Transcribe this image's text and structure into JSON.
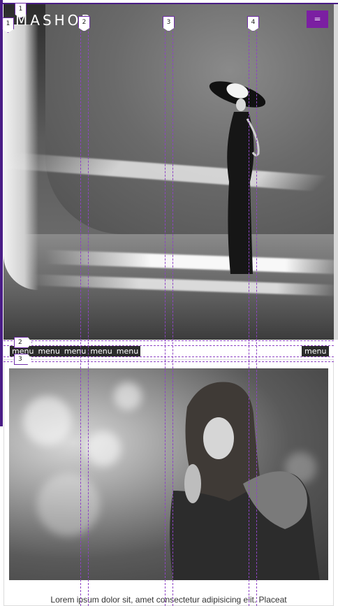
{
  "header": {
    "brand": "MASHOP",
    "menu_toggle_label": "="
  },
  "nav": {
    "items": [
      "menu",
      "menu",
      "menu",
      "menu",
      "menu"
    ],
    "right_item": "menu"
  },
  "content": {
    "caption": "Lorem ipsum dolor sit, amet consectetur adipisicing elit. Placeat"
  },
  "grid_overlay": {
    "column_markers": [
      "1",
      "2",
      "3",
      "4"
    ],
    "row_markers": [
      "1",
      "2",
      "3"
    ]
  },
  "colors": {
    "accent": "#7b1fa2",
    "guide": "#8e44c4",
    "nav_bg": "#2b2b2b"
  }
}
